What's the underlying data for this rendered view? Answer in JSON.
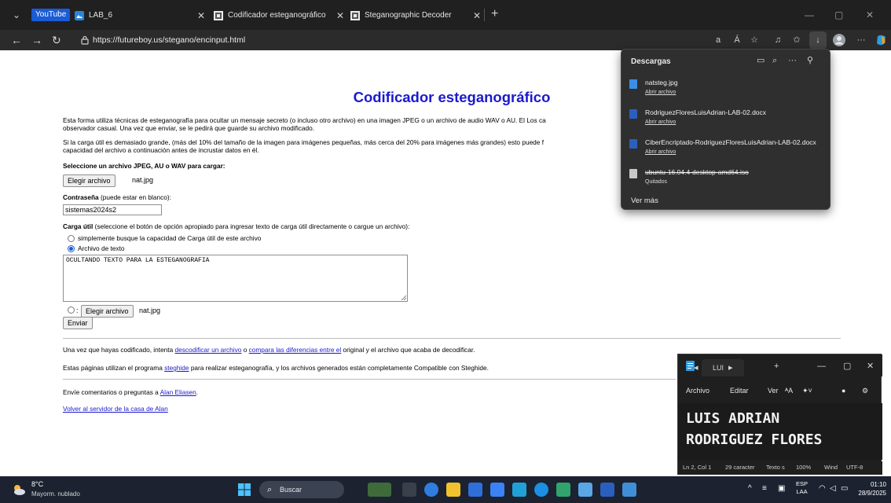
{
  "browser": {
    "tabs": [
      {
        "label": "YouTube"
      },
      {
        "label": "LAB_6"
      },
      {
        "label": "Codificador esteganográfico"
      },
      {
        "label": "Steganographic Decoder"
      }
    ],
    "url": "https://futureboy.us/stegano/encinput.html",
    "toolbar": {
      "translate": "aあ",
      "read_aloud": "Á",
      "more": "···"
    }
  },
  "page": {
    "title": "Codificador esteganográfico",
    "intro_line1": "Esta forma utiliza técnicas de esteganografía para ocultar un mensaje secreto (o incluso otro archivo) en una imagen JPEG o un archivo de audio WAV o AU. El Los ca",
    "intro_line2": "observador casual. Una vez que enviar, se le pedirá que guarde su archivo modificado.",
    "size_line1": "Si la carga útil es demasiado grande, (más del 10% del tamaño de la imagen para imágenes pequeñas, más cerca del 20% para imágenes más grandes) esto puede f",
    "size_line2": "capacidad del archivo a continuación antes de incrustar datos en él.",
    "file_label": "Seleccione un archivo JPEG, AU o WAV para cargar:",
    "choose_file_btn": "Elegir archivo",
    "chosen_file": "nat.jpg",
    "password_label": "Contraseña",
    "password_hint": " (puede estar en blanco):",
    "password_value": "sistemas2024s2",
    "payload_label": "Carga útil",
    "payload_hint": " (seleccione el botón de opción apropiado para ingresar texto de carga útil directamente o cargue un archivo):",
    "radio1_label": "simplemente busque la capacidad de Carga útil de este archivo",
    "radio2_label": "Archivo de texto",
    "textarea_value": "OCULTANDO TEXTO PARA LA ESTEGANOGRAFIA",
    "radio3_colon": ":",
    "choose_file_btn2": "Elegir archivo",
    "chosen_file2": "nat.jpg",
    "submit": "Enviar",
    "after_text_a": "Una vez que hayas codificado, intenta ",
    "after_link1": "descodificar un archivo",
    "after_text_b": " o ",
    "after_link2": "compara las diferencias entre el",
    "after_text_c": " original y el archivo que acaba de decodificar.",
    "steghide_text_a": "Estas páginas utilizan el programa ",
    "steghide_link": "steghide",
    "steghide_text_b": " para realizar esteganografía, y los archivos generados están completamente Compatible con Steghide.",
    "feedback_text": "Envíe comentarios o preguntas a ",
    "feedback_link": "Alan Eliasen",
    "feedback_end": ".",
    "home_link": "Volver al servidor de la casa de Alan"
  },
  "downloads": {
    "title": "Descargas",
    "items": [
      {
        "name": "natsteg.jpg",
        "action": "Abrir archivo"
      },
      {
        "name": "RodriguezFloresLuisAdrian-LAB-02.docx",
        "action": "Abrir archivo"
      },
      {
        "name": "CiberEncriptado-RodriguezFloresLuisAdrian-LAB-02.docx",
        "action": "Abrir archivo"
      },
      {
        "name": "ubuntu-16.04.4-desktop-amd64.iso",
        "action": "Quitados"
      }
    ],
    "more": "Ver más"
  },
  "notepad": {
    "tab_label": "LUI",
    "menu": [
      "Archivo",
      "Editar",
      "Ver"
    ],
    "text": "LUIS ADRIAN\nRODRIGUEZ FLORES",
    "status": {
      "pos": "Ln 2, Col 1",
      "chars": "29 caracter",
      "type": "Texto s",
      "zoom": "100%",
      "eol": "Wind",
      "enc": "UTF-8"
    }
  },
  "taskbar": {
    "temp": "8°C",
    "weather": "Mayorm. nublado",
    "search": "Buscar",
    "lang_top": "ESP",
    "lang_bottom": "LAA",
    "time": "01:10",
    "date": "28/9/2025"
  },
  "colors": {
    "link": "#1a1acd",
    "accent": "#1a5bd6",
    "taskbar": "#1c2230"
  }
}
